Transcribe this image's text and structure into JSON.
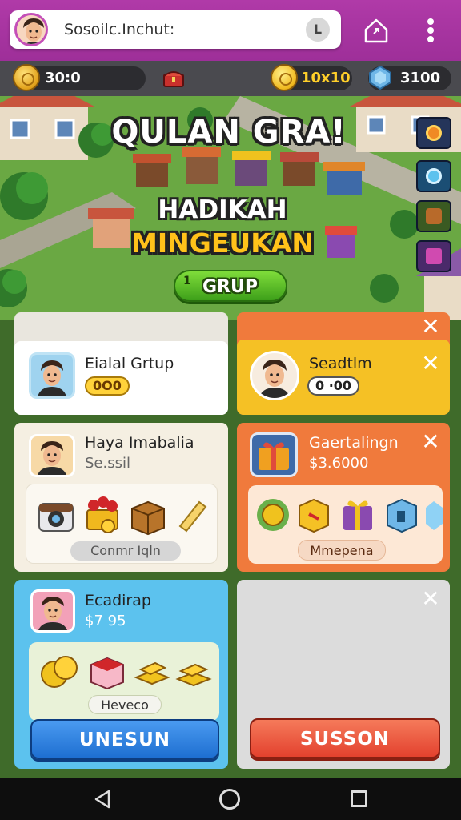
{
  "appbar": {
    "search_text": "Sosoilc.Inchut:",
    "search_button": "L",
    "home_icon": "home-icon",
    "menu_icon": "more-vertical-icon"
  },
  "currency": {
    "coins": "30:0",
    "gold": "10x10",
    "gems": "3100"
  },
  "scene": {
    "title": "QULAN GRA!",
    "subtitle_1": "HADIKAH",
    "subtitle_2": "MINGEUKAN",
    "button_number": "1",
    "button_label": "GRUP"
  },
  "cards": {
    "c1": {
      "title": "Eialal Grtup",
      "value": "0O0"
    },
    "c2": {
      "title": "Seadtlm",
      "value": "0 ·00"
    },
    "c3": {
      "title": "Haya Imabalia",
      "subtitle": "Se.ssil",
      "button": "Conmr Iqln"
    },
    "c4": {
      "title": "Gaertalingn",
      "price": "$3.6000",
      "button": "Mmepena"
    },
    "c5": {
      "title": "Ecadirap",
      "price": "$7 95",
      "badge": "Heveco",
      "button": "UNESUN"
    },
    "c6": {
      "button": "SUSSON"
    }
  },
  "colors": {
    "appbar": "#a8369f",
    "green_button": "#4caf1f",
    "orange_card": "#f07a3c",
    "yellow_card": "#f5c125",
    "blue_card": "#5cc2ee",
    "blue_button": "#1e6fd1",
    "red_button": "#ee4b3b"
  },
  "navbar": {
    "back_icon": "back-triangle-icon",
    "home_icon": "home-circle-icon",
    "recent_icon": "recent-square-icon"
  }
}
